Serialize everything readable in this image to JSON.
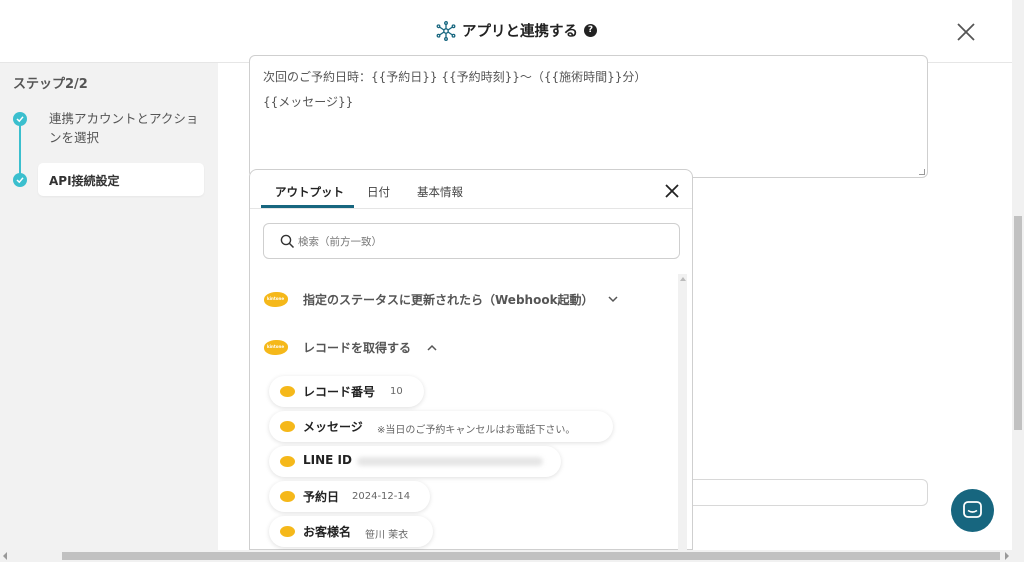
{
  "header": {
    "title": "アプリと連携する",
    "help_glyph": "?",
    "hub_icon": "hub-network-icon",
    "close_icon": "close-icon"
  },
  "sidebar": {
    "step_title": "ステップ2/2",
    "steps": [
      {
        "label": "連携アカウントとアクションを選択",
        "status": "done"
      },
      {
        "label": "API接続設定",
        "status": "current"
      }
    ],
    "accent": "#3bbfce"
  },
  "main": {
    "message_lines": [
      "次回のご予約日時：{{予約日}} {{予約時刻}}〜（{{施術時間}}分）",
      "{{メッセージ}}"
    ]
  },
  "popup": {
    "tabs": [
      {
        "label": "アウトプット",
        "active": true
      },
      {
        "label": "日付",
        "active": false
      },
      {
        "label": "基本情報",
        "active": false
      }
    ],
    "search_placeholder": "検索（前方一致）",
    "search_value": "",
    "sections": [
      {
        "title": "指定のステータスに更新されたら（Webhook起動）",
        "expanded": false,
        "logo_text": "kintone"
      },
      {
        "title": "レコードを取得する",
        "expanded": true,
        "logo_text": "kintone"
      }
    ],
    "fields": [
      {
        "name": "レコード番号",
        "value": "10"
      },
      {
        "name": "メッセージ",
        "value": "※当日のご予約キャンセルはお電話下さい。"
      },
      {
        "name": "LINE ID",
        "value": ""
      },
      {
        "name": "予約日",
        "value": "2024-12-14"
      },
      {
        "name": "お客様名",
        "value": "笹川 茉衣"
      }
    ],
    "accent": "#17667f"
  },
  "chat_widget": {
    "icon": "chat-icon",
    "color": "#17667f"
  }
}
